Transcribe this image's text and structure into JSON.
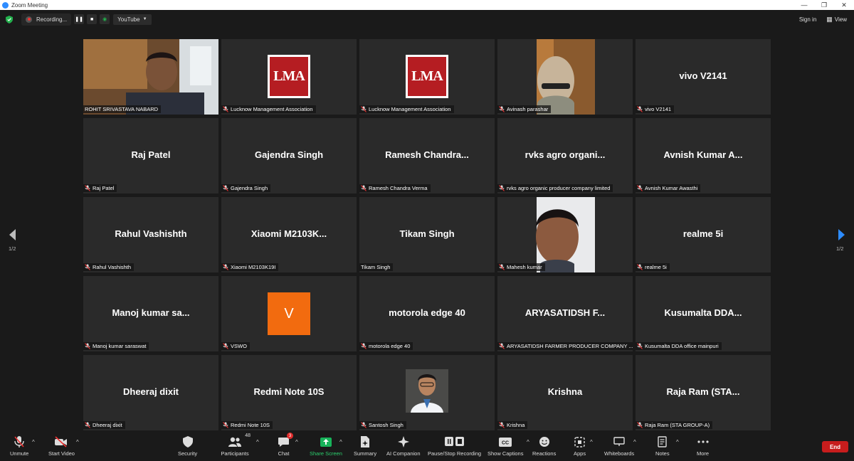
{
  "window": {
    "title": "Zoom Meeting"
  },
  "topbar": {
    "recording_label": "Recording...",
    "stream_label": "YouTube",
    "signin_label": "Sign in",
    "view_label": "View"
  },
  "pagination": {
    "left": "1/2",
    "right": "1/2"
  },
  "tiles": [
    {
      "big": "",
      "label": "ROHIT SRIVASTAVA NABARD",
      "muted": false,
      "kind": "video-man"
    },
    {
      "big": "",
      "label": "Lucknow Management Association",
      "muted": true,
      "kind": "lma-logo"
    },
    {
      "big": "",
      "label": "Lucknow Management Association",
      "muted": true,
      "kind": "lma-logo"
    },
    {
      "big": "",
      "label": "Avinash parashar",
      "muted": true,
      "kind": "video-avinash"
    },
    {
      "big": "vivo V2141",
      "label": "vivo V2141",
      "muted": true,
      "kind": "name"
    },
    {
      "big": "Raj Patel",
      "label": "Raj Patel",
      "muted": true,
      "kind": "name"
    },
    {
      "big": "Gajendra Singh",
      "label": "Gajendra Singh",
      "muted": true,
      "kind": "name"
    },
    {
      "big": "Ramesh  Chandra...",
      "label": "Ramesh Chandra Verma",
      "muted": true,
      "kind": "name"
    },
    {
      "big": "rvks agro organi...",
      "label": "rvks agro organic producer company limited",
      "muted": true,
      "kind": "name"
    },
    {
      "big": "Avnish Kumar A...",
      "label": "Avnish Kumar Awasthi",
      "muted": true,
      "kind": "name"
    },
    {
      "big": "Rahul Vashishth",
      "label": "Rahul Vashishth",
      "muted": true,
      "kind": "name"
    },
    {
      "big": "Xiaomi  M2103K...",
      "label": "Xiaomi M2103K19I",
      "muted": true,
      "kind": "name"
    },
    {
      "big": "Tikam Singh",
      "label": "Tikam Singh",
      "muted": false,
      "kind": "name"
    },
    {
      "big": "",
      "label": "Mahesh kumar",
      "muted": true,
      "kind": "video-mahesh"
    },
    {
      "big": "realme 5i",
      "label": "realme 5i",
      "muted": true,
      "kind": "name"
    },
    {
      "big": "Manoj kumar sa...",
      "label": "Manoj kumar saraswat",
      "muted": true,
      "kind": "name"
    },
    {
      "big": "V",
      "label": "VSWO",
      "muted": true,
      "kind": "avatar-v"
    },
    {
      "big": "motorola edge 40",
      "label": "motorola edge 40",
      "muted": true,
      "kind": "name"
    },
    {
      "big": "ARYASATIDSH  F...",
      "label": "ARYASATIDSH FARMER PRODUCER COMPANY ...",
      "muted": true,
      "kind": "name"
    },
    {
      "big": "Kusumalta  DDA...",
      "label": "Kusumalta DDA office mainpuri",
      "muted": true,
      "kind": "name"
    },
    {
      "big": "Dheeraj dixit",
      "label": "Dheeraj dixit",
      "muted": true,
      "kind": "name"
    },
    {
      "big": "Redmi Note 10S",
      "label": "Redmi Note 10S",
      "muted": true,
      "kind": "name"
    },
    {
      "big": "",
      "label": "Santosh Singh",
      "muted": true,
      "kind": "photo-santosh"
    },
    {
      "big": "Krishna",
      "label": "Krishna",
      "muted": true,
      "kind": "name"
    },
    {
      "big": "Raja Ram   (STA...",
      "label": "Raja Ram  (STA GROUP-A)",
      "muted": true,
      "kind": "name"
    }
  ],
  "lma_logo_text": "LMA",
  "controls": {
    "unmute": "Unmute",
    "start_video": "Start Video",
    "security": "Security",
    "participants": "Participants",
    "participants_count": "48",
    "chat": "Chat",
    "chat_badge": "3",
    "share_screen": "Share Screen",
    "summary": "Summary",
    "ai_companion": "AI Companion",
    "pause_stop_recording": "Pause/Stop Recording",
    "show_captions": "Show Captions",
    "reactions": "Reactions",
    "apps": "Apps",
    "whiteboards": "Whiteboards",
    "notes": "Notes",
    "more": "More",
    "end": "End"
  },
  "colors": {
    "background": "#1a1a1a",
    "tile": "#2a2a2a",
    "active_speaker_border": "#c8e34a",
    "end_button": "#c71d1d",
    "share_green": "#17b35a",
    "avatar_orange": "#f26b0f",
    "accent_blue": "#2d8cff"
  }
}
